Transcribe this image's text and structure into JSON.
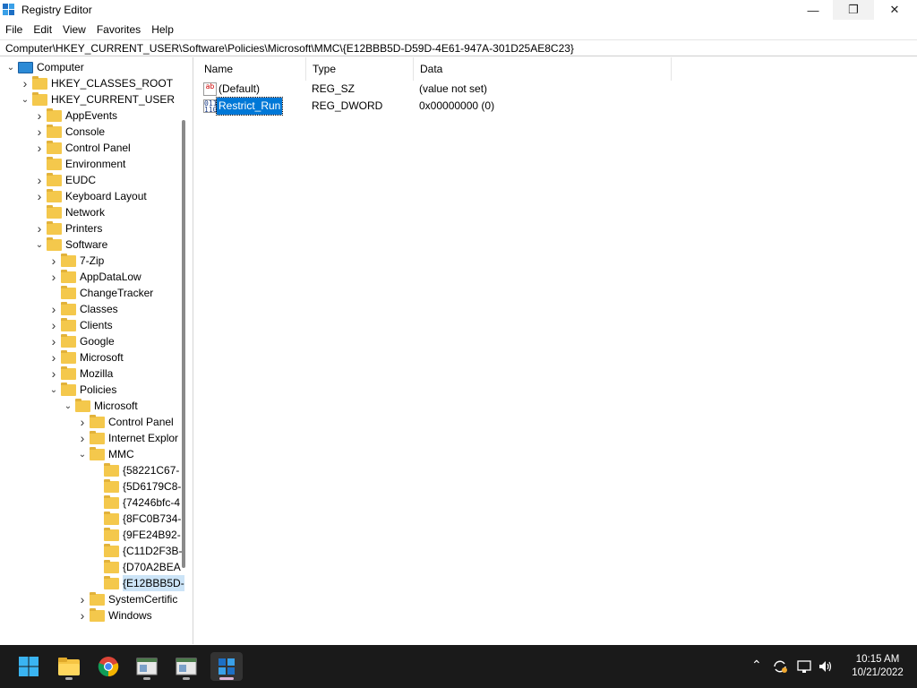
{
  "window": {
    "title": "Registry Editor",
    "min": "—",
    "max": "❐",
    "close": "✕"
  },
  "menu": [
    "File",
    "Edit",
    "View",
    "Favorites",
    "Help"
  ],
  "address": "Computer\\HKEY_CURRENT_USER\\Software\\Policies\\Microsoft\\MMC\\{E12BBB5D-D59D-4E61-947A-301D25AE8C23}",
  "tree": [
    {
      "label": "Computer",
      "level": 0,
      "expander": "expanded",
      "icon": "computer-icon"
    },
    {
      "label": "HKEY_CLASSES_ROOT",
      "level": 1,
      "expander": "collapsed"
    },
    {
      "label": "HKEY_CURRENT_USER",
      "level": 1,
      "expander": "expanded"
    },
    {
      "label": "AppEvents",
      "level": 2,
      "expander": "collapsed"
    },
    {
      "label": "Console",
      "level": 2,
      "expander": "collapsed"
    },
    {
      "label": "Control Panel",
      "level": 2,
      "expander": "collapsed"
    },
    {
      "label": "Environment",
      "level": 2,
      "expander": "none"
    },
    {
      "label": "EUDC",
      "level": 2,
      "expander": "collapsed"
    },
    {
      "label": "Keyboard Layout",
      "level": 2,
      "expander": "collapsed"
    },
    {
      "label": "Network",
      "level": 2,
      "expander": "none"
    },
    {
      "label": "Printers",
      "level": 2,
      "expander": "collapsed"
    },
    {
      "label": "Software",
      "level": 2,
      "expander": "expanded"
    },
    {
      "label": "7-Zip",
      "level": 3,
      "expander": "collapsed"
    },
    {
      "label": "AppDataLow",
      "level": 3,
      "expander": "collapsed"
    },
    {
      "label": "ChangeTracker",
      "level": 3,
      "expander": "none"
    },
    {
      "label": "Classes",
      "level": 3,
      "expander": "collapsed"
    },
    {
      "label": "Clients",
      "level": 3,
      "expander": "collapsed"
    },
    {
      "label": "Google",
      "level": 3,
      "expander": "collapsed"
    },
    {
      "label": "Microsoft",
      "level": 3,
      "expander": "collapsed"
    },
    {
      "label": "Mozilla",
      "level": 3,
      "expander": "collapsed"
    },
    {
      "label": "Policies",
      "level": 3,
      "expander": "expanded"
    },
    {
      "label": "Microsoft",
      "level": 4,
      "expander": "expanded"
    },
    {
      "label": "Control Panel",
      "level": 5,
      "expander": "collapsed"
    },
    {
      "label": "Internet Explor",
      "level": 5,
      "expander": "collapsed"
    },
    {
      "label": "MMC",
      "level": 5,
      "expander": "expanded"
    },
    {
      "label": "{58221C67-",
      "level": 6,
      "expander": "none"
    },
    {
      "label": "{5D6179C8-",
      "level": 6,
      "expander": "none"
    },
    {
      "label": "{74246bfc-4",
      "level": 6,
      "expander": "none"
    },
    {
      "label": "{8FC0B734-",
      "level": 6,
      "expander": "none"
    },
    {
      "label": "{9FE24B92-",
      "level": 6,
      "expander": "none"
    },
    {
      "label": "{C11D2F3B-",
      "level": 6,
      "expander": "none"
    },
    {
      "label": "{D70A2BEA",
      "level": 6,
      "expander": "none"
    },
    {
      "label": "{E12BBB5D-",
      "level": 6,
      "expander": "none",
      "selected": true
    },
    {
      "label": "SystemCertific",
      "level": 5,
      "expander": "collapsed"
    },
    {
      "label": "Windows",
      "level": 5,
      "expander": "collapsed"
    }
  ],
  "columns": {
    "name": "Name",
    "type": "Type",
    "data": "Data"
  },
  "values": [
    {
      "name": "(Default)",
      "type": "REG_SZ",
      "data": "(value not set)",
      "icon": "string-value-icon",
      "glyph": "ab"
    },
    {
      "name": "Restrict_Run",
      "type": "REG_DWORD",
      "data": "0x00000000 (0)",
      "icon": "binary-value-icon",
      "glyph": "011\n110",
      "selected": true
    }
  ],
  "taskbar": {
    "apps": [
      "start",
      "file-explorer",
      "chrome",
      "app-1",
      "app-2",
      "registry-editor"
    ],
    "clock_time": "10:15 AM",
    "clock_date": "10/21/2022"
  }
}
